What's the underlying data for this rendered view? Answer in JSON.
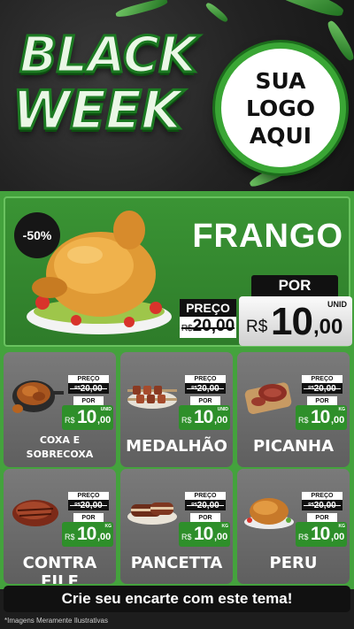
{
  "header": {
    "black_label": "BLACK",
    "week_label": "WEEK",
    "logo_lines": [
      "SUA",
      "LOGO",
      "AQUI"
    ]
  },
  "hero": {
    "discount": "-50%",
    "name": "FRANGO",
    "por_label": "POR",
    "preco_label": "PREÇO",
    "old_price": "R$20,00",
    "old_currency": "R$",
    "old_value": "20,00",
    "new_currency": "R$",
    "new_int": "10",
    "new_dec": ",00",
    "unit": "UNID"
  },
  "price_labels": {
    "preco": "PREÇO",
    "por": "POR"
  },
  "products": [
    {
      "name": "COXA E SOBRECOXA",
      "name_line1": "COXA E",
      "name_line2": "SOBRECOXA",
      "old_currency": "R$",
      "old_value": "20,00",
      "new_currency": "R$",
      "new_int": "10",
      "new_dec": ",00",
      "unit": "UNID",
      "icon": "chicken-pot-icon"
    },
    {
      "name": "MEDALHÃO",
      "old_currency": "R$",
      "old_value": "20,00",
      "new_currency": "R$",
      "new_int": "10",
      "new_dec": ",00",
      "unit": "UNID",
      "icon": "skewers-icon"
    },
    {
      "name": "PICANHA",
      "old_currency": "R$",
      "old_value": "20,00",
      "new_currency": "R$",
      "new_int": "10",
      "new_dec": ",00",
      "unit": "KG",
      "icon": "steak-board-icon"
    },
    {
      "name": "CONTRA FILE",
      "old_currency": "R$",
      "old_value": "20,00",
      "new_currency": "R$",
      "new_int": "10",
      "new_dec": ",00",
      "unit": "KG",
      "icon": "steak-icon"
    },
    {
      "name": "PANCETTA",
      "old_currency": "R$",
      "old_value": "20,00",
      "new_currency": "R$",
      "new_int": "10",
      "new_dec": ",00",
      "unit": "KG",
      "icon": "pancetta-icon"
    },
    {
      "name": "PERU",
      "old_currency": "R$",
      "old_value": "20,00",
      "new_currency": "R$",
      "new_int": "10",
      "new_dec": ",00",
      "unit": "KG",
      "icon": "roast-turkey-icon"
    }
  ],
  "footer": {
    "cta": "Crie seu encarte com este tema!",
    "disclaimer": "*Imagens Meramente Ilustrativas"
  },
  "colors": {
    "green": "#44a23d",
    "dark": "#111111",
    "card": "#6d6d6d"
  }
}
